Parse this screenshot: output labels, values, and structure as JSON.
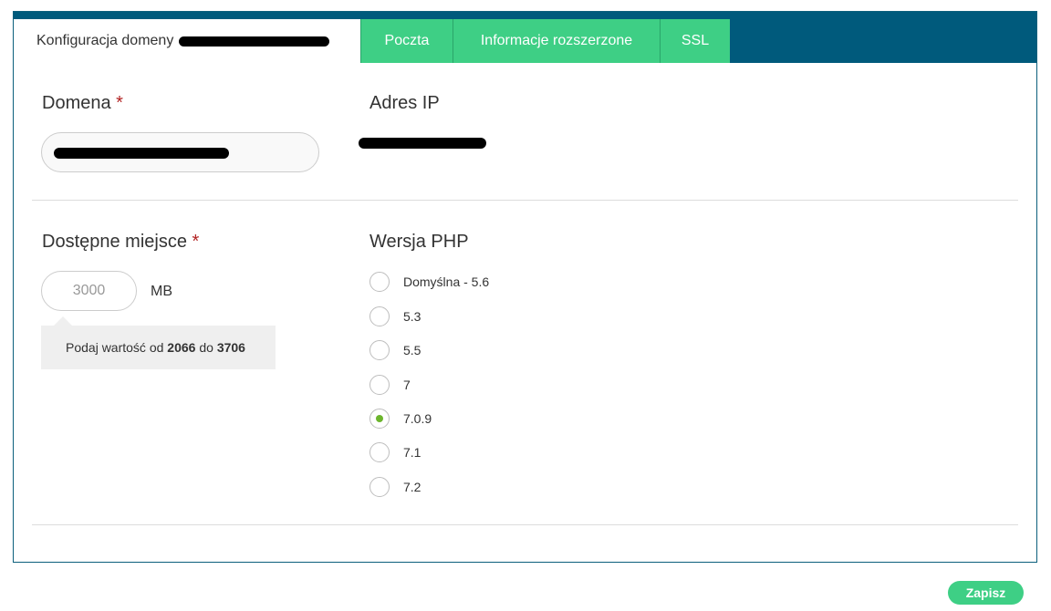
{
  "tabs": {
    "active": "Konfiguracja domeny",
    "mail": "Poczta",
    "extended": "Informacje rozszerzone",
    "ssl": "SSL"
  },
  "domain": {
    "label": "Domena",
    "required_mark": "*"
  },
  "ip": {
    "label": "Adres IP"
  },
  "space": {
    "label": "Dostępne miejsce",
    "required_mark": "*",
    "value": "3000",
    "unit": "MB",
    "hint_prefix": "Podaj wartość od",
    "hint_min": "2066",
    "hint_mid": "do",
    "hint_max": "3706"
  },
  "php": {
    "label": "Wersja PHP",
    "options": [
      "Domyślna - 5.6",
      "5.3",
      "5.5",
      "7",
      "7.0.9",
      "7.1",
      "7.2"
    ],
    "selected": "7.0.9"
  },
  "save_label": "Zapisz",
  "colors": {
    "tabbar": "#005a7c",
    "tab_green": "#3ecf85",
    "radio_checked": "#6cb52d",
    "required": "#b22222"
  }
}
